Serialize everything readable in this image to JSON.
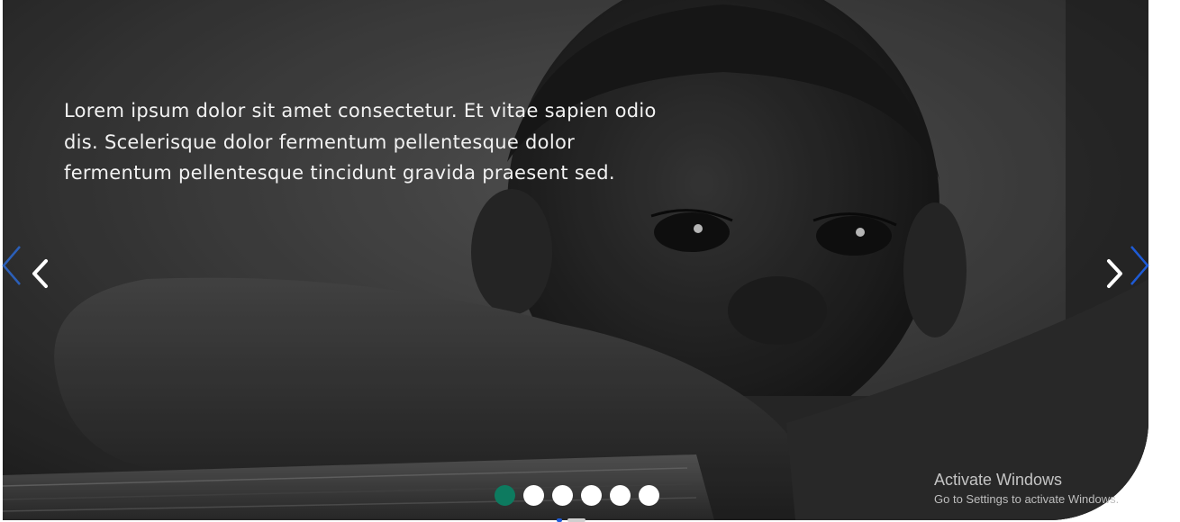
{
  "slide": {
    "caption": "Lorem ipsum dolor sit amet consectetur. Et vitae sapien odio dis. Scelerisque dolor fermentum pellentesque dolor fermentum pellentesque tincidunt gravida praesent sed.",
    "image": "grayscale-photo-child-resting-arms-on-wooden-fence"
  },
  "navigation": {
    "prev_icon": "chevron-left-icon",
    "next_icon": "chevron-right-icon",
    "edge_accent_color": "#1e5bd6"
  },
  "pagination": {
    "count": 6,
    "active_index": 0,
    "active_color": "#0d7a5f",
    "inactive_color": "#ffffff"
  },
  "watermark": {
    "title": "Activate Windows",
    "subtitle": "Go to Settings to activate Windows."
  }
}
